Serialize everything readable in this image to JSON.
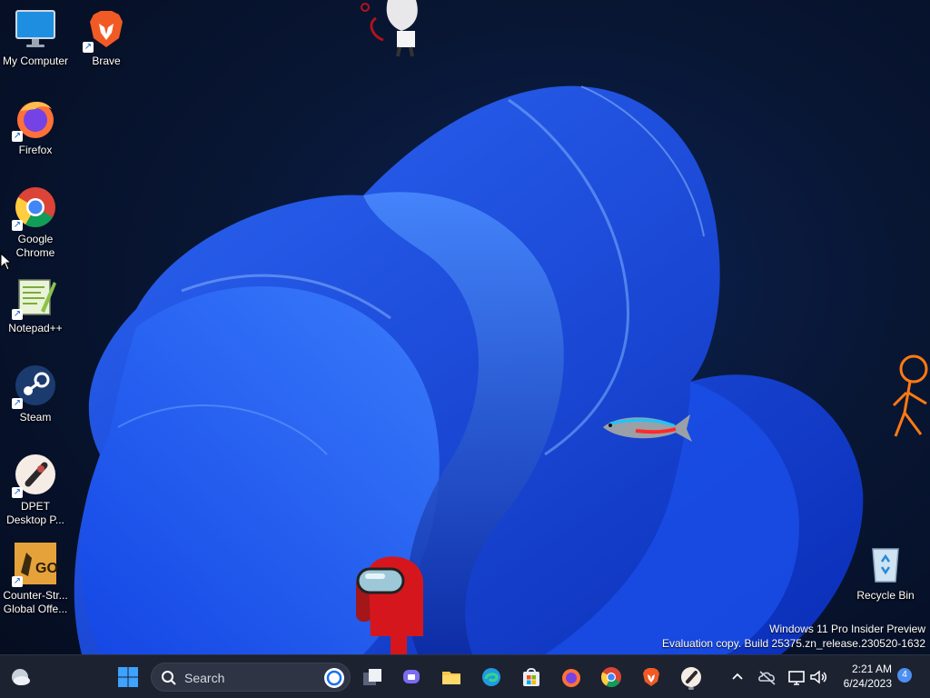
{
  "desktop_icons": [
    {
      "name": "my-computer",
      "label": "My Computer",
      "icon": "monitor-icon"
    },
    {
      "name": "brave",
      "label": "Brave",
      "icon": "brave-lion-icon",
      "shortcut": true
    },
    {
      "name": "firefox",
      "label": "Firefox",
      "icon": "firefox-icon",
      "shortcut": true
    },
    {
      "name": "google-chrome",
      "label": "Google\nChrome",
      "icon": "chrome-icon",
      "shortcut": true
    },
    {
      "name": "notepadpp",
      "label": "Notepad++",
      "icon": "notepadpp-icon",
      "shortcut": true
    },
    {
      "name": "steam",
      "label": "Steam",
      "icon": "steam-icon",
      "shortcut": true
    },
    {
      "name": "dpet",
      "label": "DPET\nDesktop P...",
      "icon": "dpet-icon",
      "shortcut": true
    },
    {
      "name": "csgo",
      "label": "Counter-Str...\nGlobal Offe...",
      "icon": "csgo-icon",
      "shortcut": true
    },
    {
      "name": "recycle-bin",
      "label": "Recycle Bin",
      "icon": "recycle-bin-icon"
    }
  ],
  "watermark": {
    "line1": "Windows 11 Pro Insider Preview",
    "line2": "Evaluation copy. Build 25375.zn_release.230520-1632"
  },
  "taskbar": {
    "search_placeholder": "Search",
    "apps": [
      "start-icon",
      "task-view-icon",
      "teams-chat-icon",
      "file-explorer-icon",
      "edge-icon",
      "store-icon",
      "firefox-icon",
      "chrome-icon",
      "brave-icon",
      "dpet-icon"
    ],
    "clock": {
      "time": "2:21 AM",
      "date": "6/24/2023"
    },
    "notification_count": "4"
  },
  "colors": {
    "taskbar_bg": "#1c2230",
    "accent": "#1a6ff0",
    "wallpaper_bg": "#081633"
  }
}
